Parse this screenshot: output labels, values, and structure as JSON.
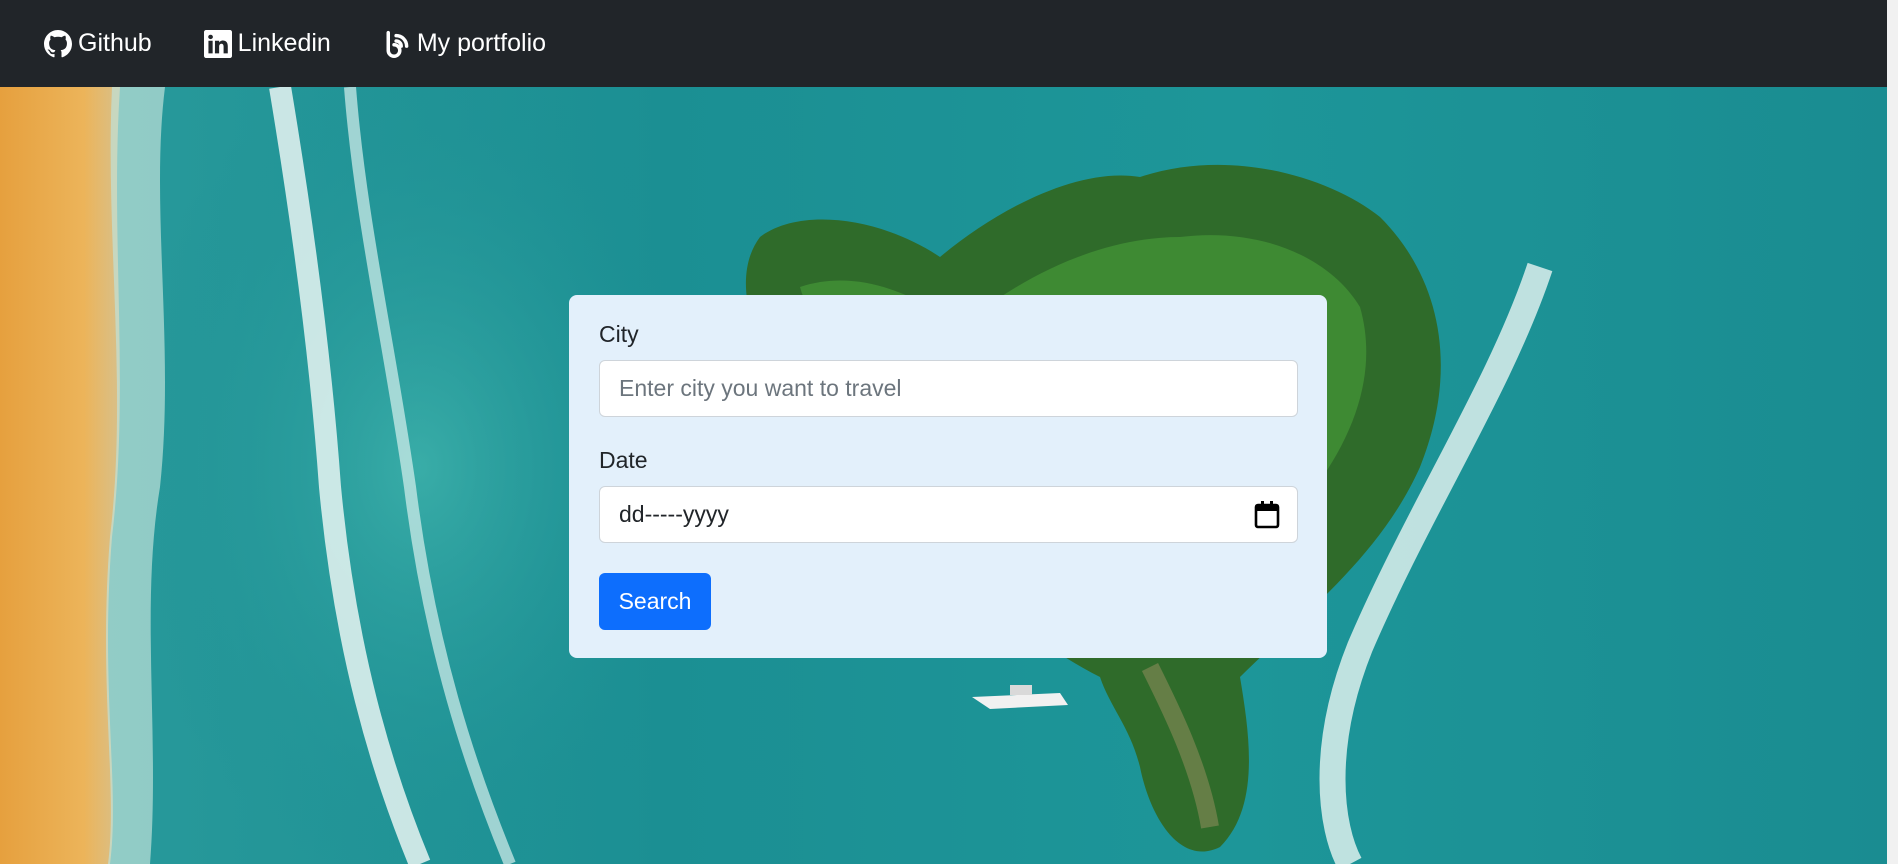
{
  "navbar": {
    "links": [
      {
        "label": "Github",
        "icon": "github-icon"
      },
      {
        "label": "Linkedin",
        "icon": "linkedin-icon"
      },
      {
        "label": "My portfolio",
        "icon": "blogger-icon"
      }
    ]
  },
  "form": {
    "city_label": "City",
    "city_placeholder": "Enter city you want to travel",
    "date_label": "Date",
    "date_value": "dd-----yyyy",
    "search_label": "Search"
  },
  "colors": {
    "navbar_bg": "#212529",
    "card_bg": "#e3f0fb",
    "button_bg": "#0d6efd",
    "sea": "#1e9a9a",
    "sand": "#e9a94b"
  }
}
